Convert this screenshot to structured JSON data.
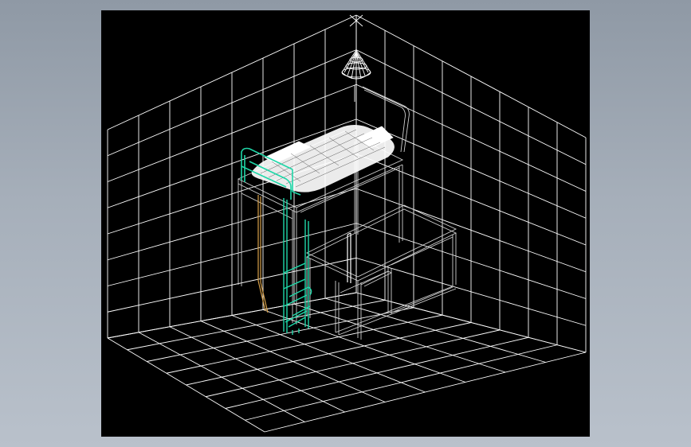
{
  "scene": {
    "type": "cad-wireframe-3d-view",
    "description_none": "",
    "colors": {
      "background": "#000000",
      "grid": "#ffffff",
      "railing": "#1fd7a8",
      "ladder_accent": "#d9a24a",
      "furniture": "#d8d8d8",
      "mattress": "#ffffff"
    },
    "objects": [
      "back-left-wall-grid",
      "back-right-wall-grid",
      "floor-grid",
      "pendant-lamp",
      "loft-bed",
      "mattress",
      "safety-railing",
      "ladder",
      "desk-unit",
      "chair"
    ]
  }
}
